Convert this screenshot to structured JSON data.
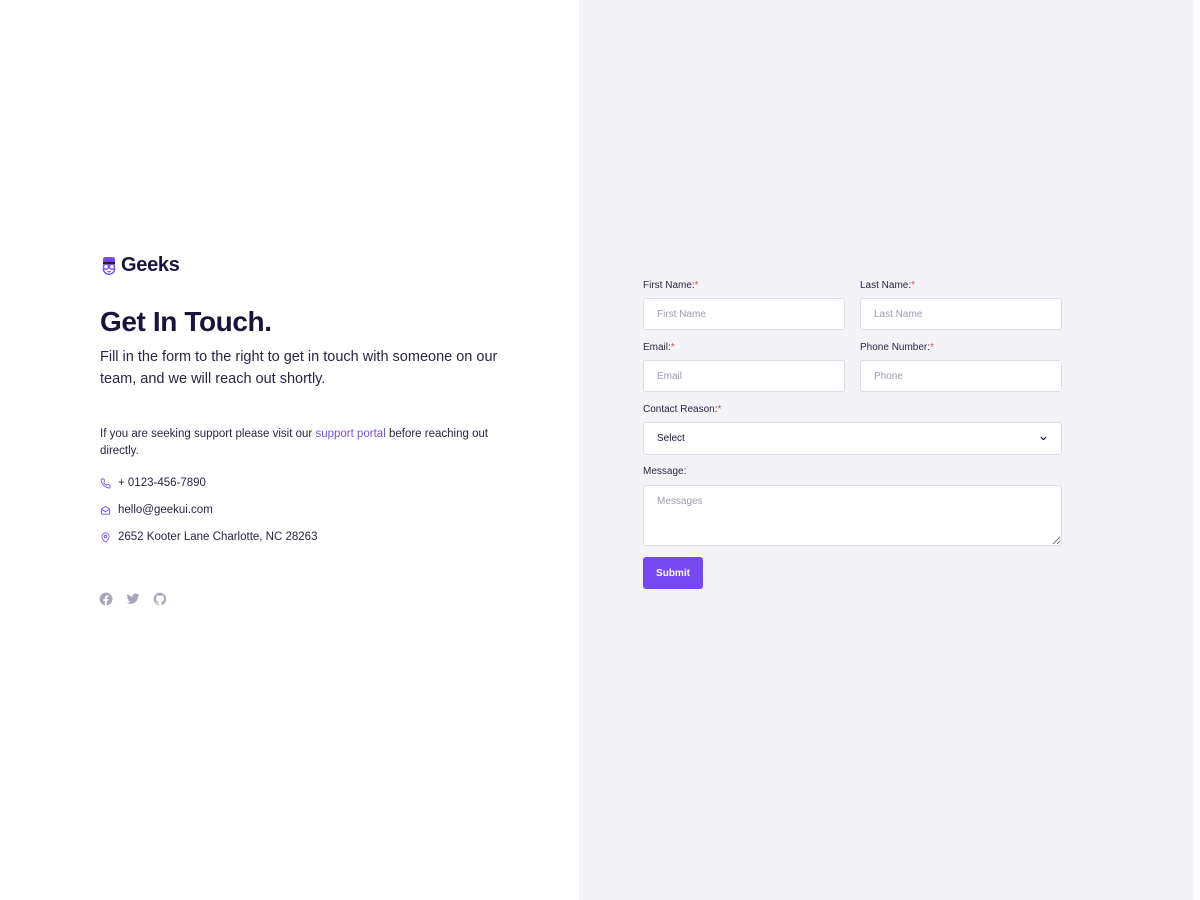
{
  "brand": {
    "name": "Geeks",
    "logo_icon": "geek-face-logo-icon",
    "accent_color": "#7449f2"
  },
  "intro": {
    "title": "Get In Touch.",
    "lead": "Fill in the form to the right to get in touch with someone on our team, and we will reach out shortly.",
    "support_before": "If you are seeking support please visit our ",
    "support_link": "support portal",
    "support_after": " before reaching out directly."
  },
  "contact": {
    "phone": "+ 0123-456-7890",
    "email": "hello@geekui.com",
    "address": "2652 Kooter Lane Charlotte, NC 28263"
  },
  "socials": [
    {
      "icon": "facebook-icon"
    },
    {
      "icon": "twitter-icon"
    },
    {
      "icon": "github-icon"
    }
  ],
  "form": {
    "required_mark": "*",
    "first_name": {
      "label": "First Name:",
      "placeholder": "First Name",
      "value": ""
    },
    "last_name": {
      "label": "Last Name:",
      "placeholder": "Last Name",
      "value": ""
    },
    "email": {
      "label": "Email:",
      "placeholder": "Email",
      "value": ""
    },
    "phone": {
      "label": "Phone Number:",
      "placeholder": "Phone",
      "value": ""
    },
    "contact_reason": {
      "label": "Contact Reason:",
      "selected": "Select"
    },
    "message": {
      "label": "Message:",
      "placeholder": "Messages",
      "value": ""
    },
    "submit_label": "Submit"
  }
}
